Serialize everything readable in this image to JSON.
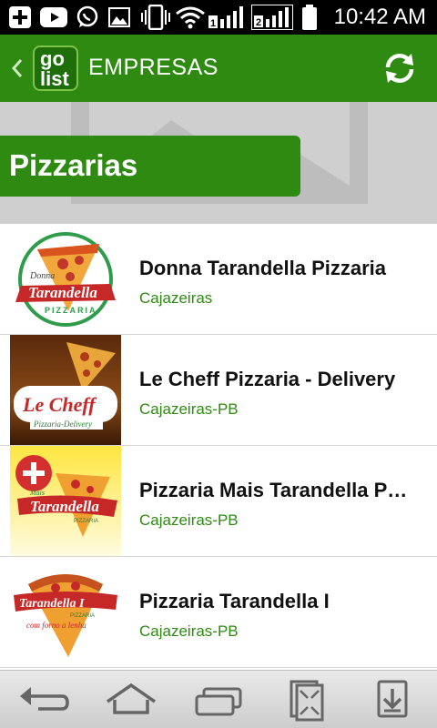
{
  "status_bar": {
    "time": "10:42 AM",
    "icons": [
      "add-icon",
      "youtube-icon",
      "whatsapp-icon",
      "image-icon",
      "vibrate-icon",
      "wifi-icon",
      "signal-sim1-icon",
      "signal-sim2-icon",
      "battery-icon"
    ]
  },
  "action_bar": {
    "title": "EMPRESAS",
    "logo_top": "go",
    "logo_bottom": "list",
    "back_icon": "chevron-left-icon",
    "refresh_icon": "refresh-icon"
  },
  "banner": {
    "category": "Pizzarias"
  },
  "companies": [
    {
      "name": "Donna Tarandella Pizzaria",
      "location": "Cajazeiras"
    },
    {
      "name": "Le Cheff Pizzaria - Delivery",
      "location": "Cajazeiras-PB"
    },
    {
      "name": "Pizzaria Mais Tarandella Pizza",
      "location": "Cajazeiras-PB"
    },
    {
      "name": "Pizzaria Tarandella I",
      "location": "Cajazeiras-PB"
    }
  ],
  "logos": {
    "donna": {
      "script": "Tarandella",
      "top": "Donna",
      "bottom": "PIZZARIA"
    },
    "lecheff": {
      "script": "Le Cheff",
      "bottom": "Pizzaria-Delivery"
    },
    "mais": {
      "small": "Mais",
      "script": "Tarandella",
      "bottom": "PIZZARIA"
    },
    "tarandella1": {
      "script": "Tarandella I",
      "small": "PIZZARIA",
      "bottom": "com forno a lenha"
    }
  },
  "nav_bar": {
    "icons": [
      "back-icon",
      "home-icon",
      "recent-apps-icon",
      "screen-shrink-icon",
      "download-icon"
    ]
  },
  "colors": {
    "brand_green": "#2f8a12",
    "banner_grey": "#cfcfcf"
  }
}
